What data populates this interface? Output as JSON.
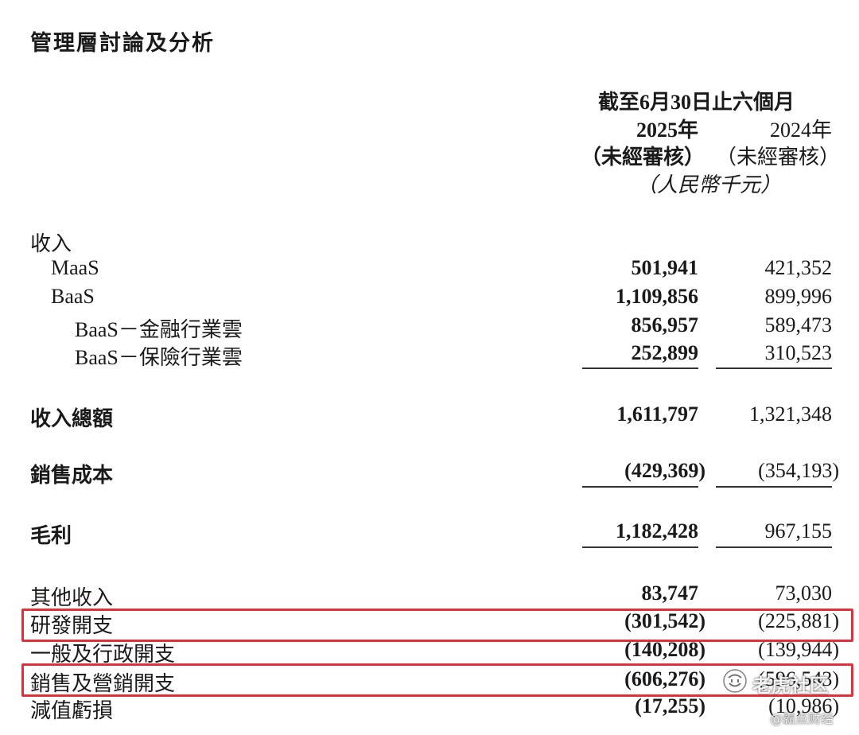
{
  "title": "管理層討論及分析",
  "header": {
    "period": "截至6月30日止六個月",
    "col1_year": "2025年",
    "col2_year": "2024年",
    "col1_note": "（未經審核）",
    "col2_note": "（未經審核）",
    "unit": "（人民幣千元）"
  },
  "rows": {
    "revenue_heading": "收入",
    "maas": {
      "label": "MaaS",
      "v2025": "501,941",
      "v2024": "421,352"
    },
    "baas": {
      "label": "BaaS",
      "v2025": "1,109,856",
      "v2024": "899,996"
    },
    "baas_finance": {
      "label": "BaaS－金融行業雲",
      "v2025": "856,957",
      "v2024": "589,473"
    },
    "baas_insurance": {
      "label": "BaaS－保險行業雲",
      "v2025": "252,899",
      "v2024": "310,523"
    },
    "total_revenue": {
      "label": "收入總額",
      "v2025": "1,611,797",
      "v2024": "1,321,348"
    },
    "cost_of_sales": {
      "label": "銷售成本",
      "v2025": "(429,369)",
      "v2024": "(354,193)"
    },
    "gross_profit": {
      "label": "毛利",
      "v2025": "1,182,428",
      "v2024": "967,155"
    },
    "other_income": {
      "label": "其他收入",
      "v2025": "83,747",
      "v2024": "73,030"
    },
    "rnd": {
      "label": "研發開支",
      "v2025": "(301,542)",
      "v2024": "(225,881)"
    },
    "admin": {
      "label": "一般及行政開支",
      "v2025": "(140,208)",
      "v2024": "(139,944)"
    },
    "selling": {
      "label": "銷售及營銷開支",
      "v2025": "(606,276)",
      "v2024": "(596,543)"
    },
    "impairment": {
      "label": "減值虧損",
      "v2025": "(17,255)",
      "v2024": "(10,986)"
    }
  },
  "highlight_color": "#e0303a",
  "watermark": {
    "main": "老虎社区",
    "sub": "@霸点财经"
  }
}
